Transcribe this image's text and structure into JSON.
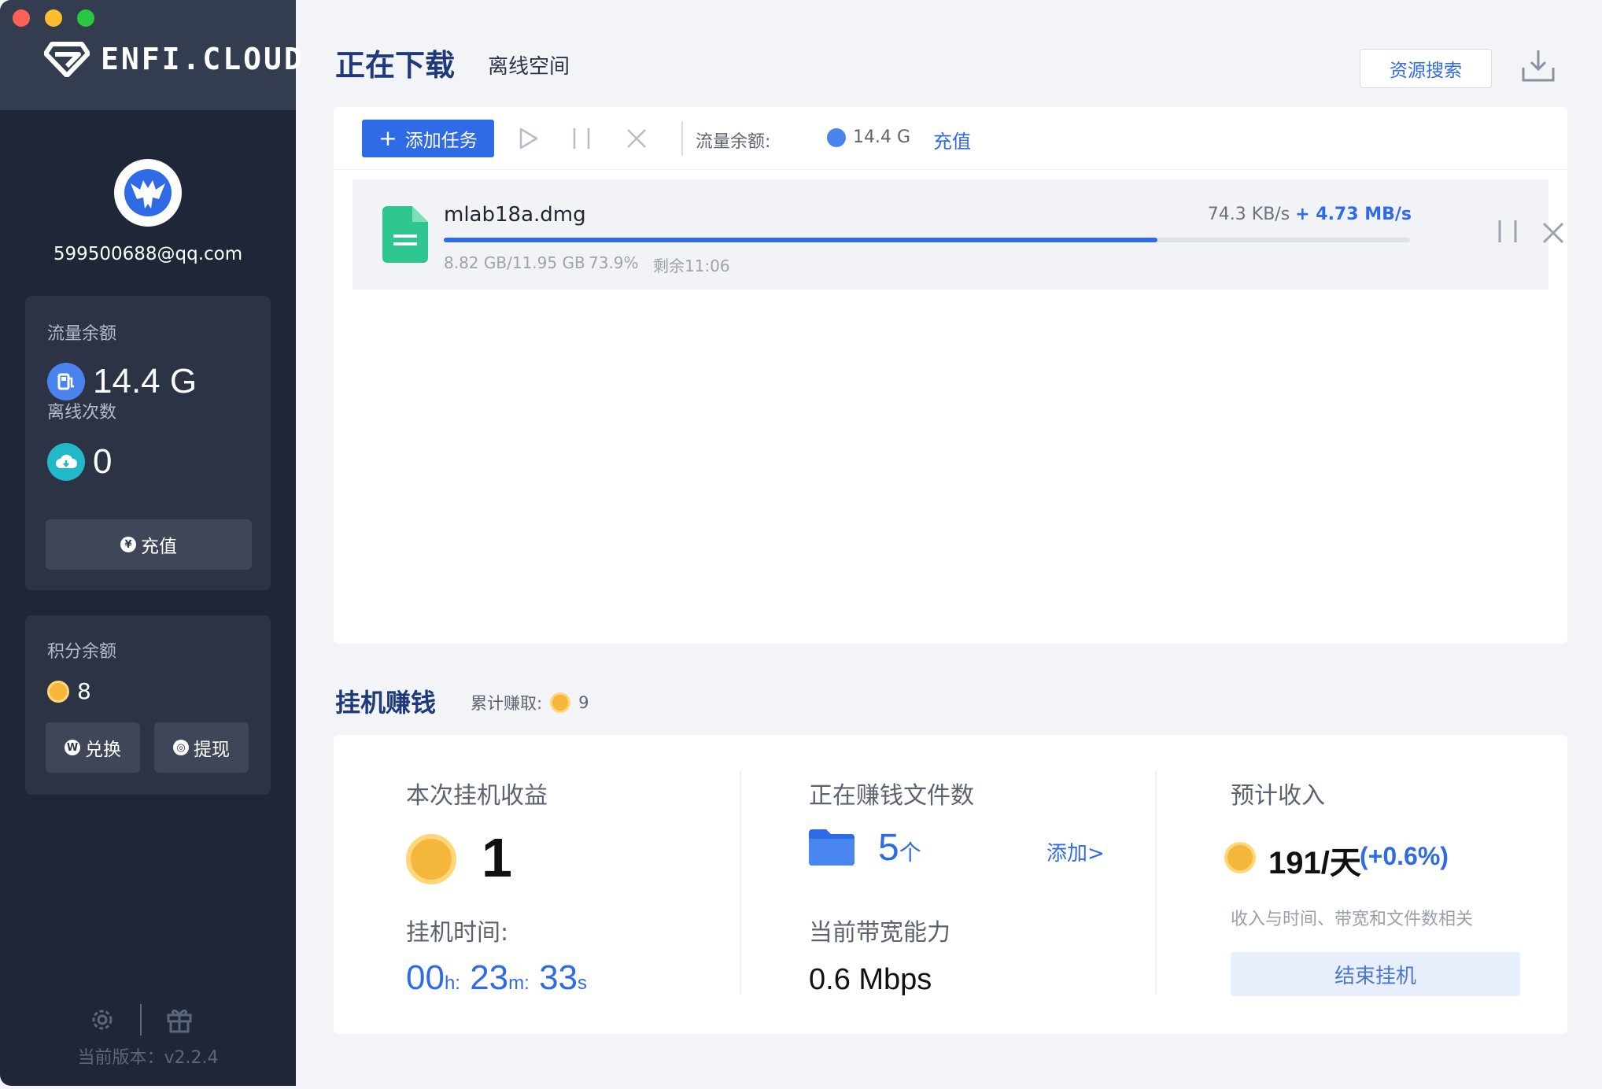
{
  "app": {
    "logo_text": "ENFI.CLOUD"
  },
  "user": {
    "email": "599500688@qq.com"
  },
  "sidebar": {
    "traffic_label": "流量余额",
    "traffic_value": "14.4 G",
    "offline_label": "离线次数",
    "offline_value": "0",
    "recharge_label": "充值",
    "points_label": "积分余额",
    "points_value": "8",
    "exchange_label": "兑换",
    "withdraw_label": "提现",
    "version": "当前版本：v2.2.4"
  },
  "header": {
    "tab_active": "正在下载",
    "tab_inactive": "离线空间",
    "search_button": "资源搜索"
  },
  "toolbar": {
    "add_task": "添加任务",
    "traffic_label": "流量余额:",
    "traffic_value": "14.4 G",
    "recharge": "充值"
  },
  "task": {
    "name": "mlab18a.dmg",
    "speed": "74.3 KB/s",
    "boost_speed": "+ 4.73 MB/s",
    "size": "8.82 GB/11.95 GB",
    "percent_text": "73.9%",
    "progress": 0.739,
    "remaining": "剩余11:06"
  },
  "earn": {
    "title": "挂机赚钱",
    "total_label": "累计赚取:",
    "total_value": "9",
    "session_label": "本次挂机收益",
    "session_value": "1",
    "time_label": "挂机时间:",
    "hours": "00",
    "h_unit": "h:",
    "minutes": "23",
    "m_unit": "m:",
    "seconds": "33",
    "s_unit": "s",
    "files_label": "正在赚钱文件数",
    "files_count": "5",
    "files_unit": "个",
    "add_link": "添加>",
    "bandwidth_label": "当前带宽能力",
    "bandwidth_value": "0.6 Mbps",
    "estimate_label": "预计收入",
    "estimate_value": "191/天",
    "estimate_change": "(+0.6%)",
    "estimate_note": "收入与时间、带宽和文件数相关",
    "stop_button": "结束挂机"
  },
  "colors": {
    "accent": "#2f6be6",
    "sidebar_bg": "#1f2637",
    "coin": "#f5b73b"
  }
}
